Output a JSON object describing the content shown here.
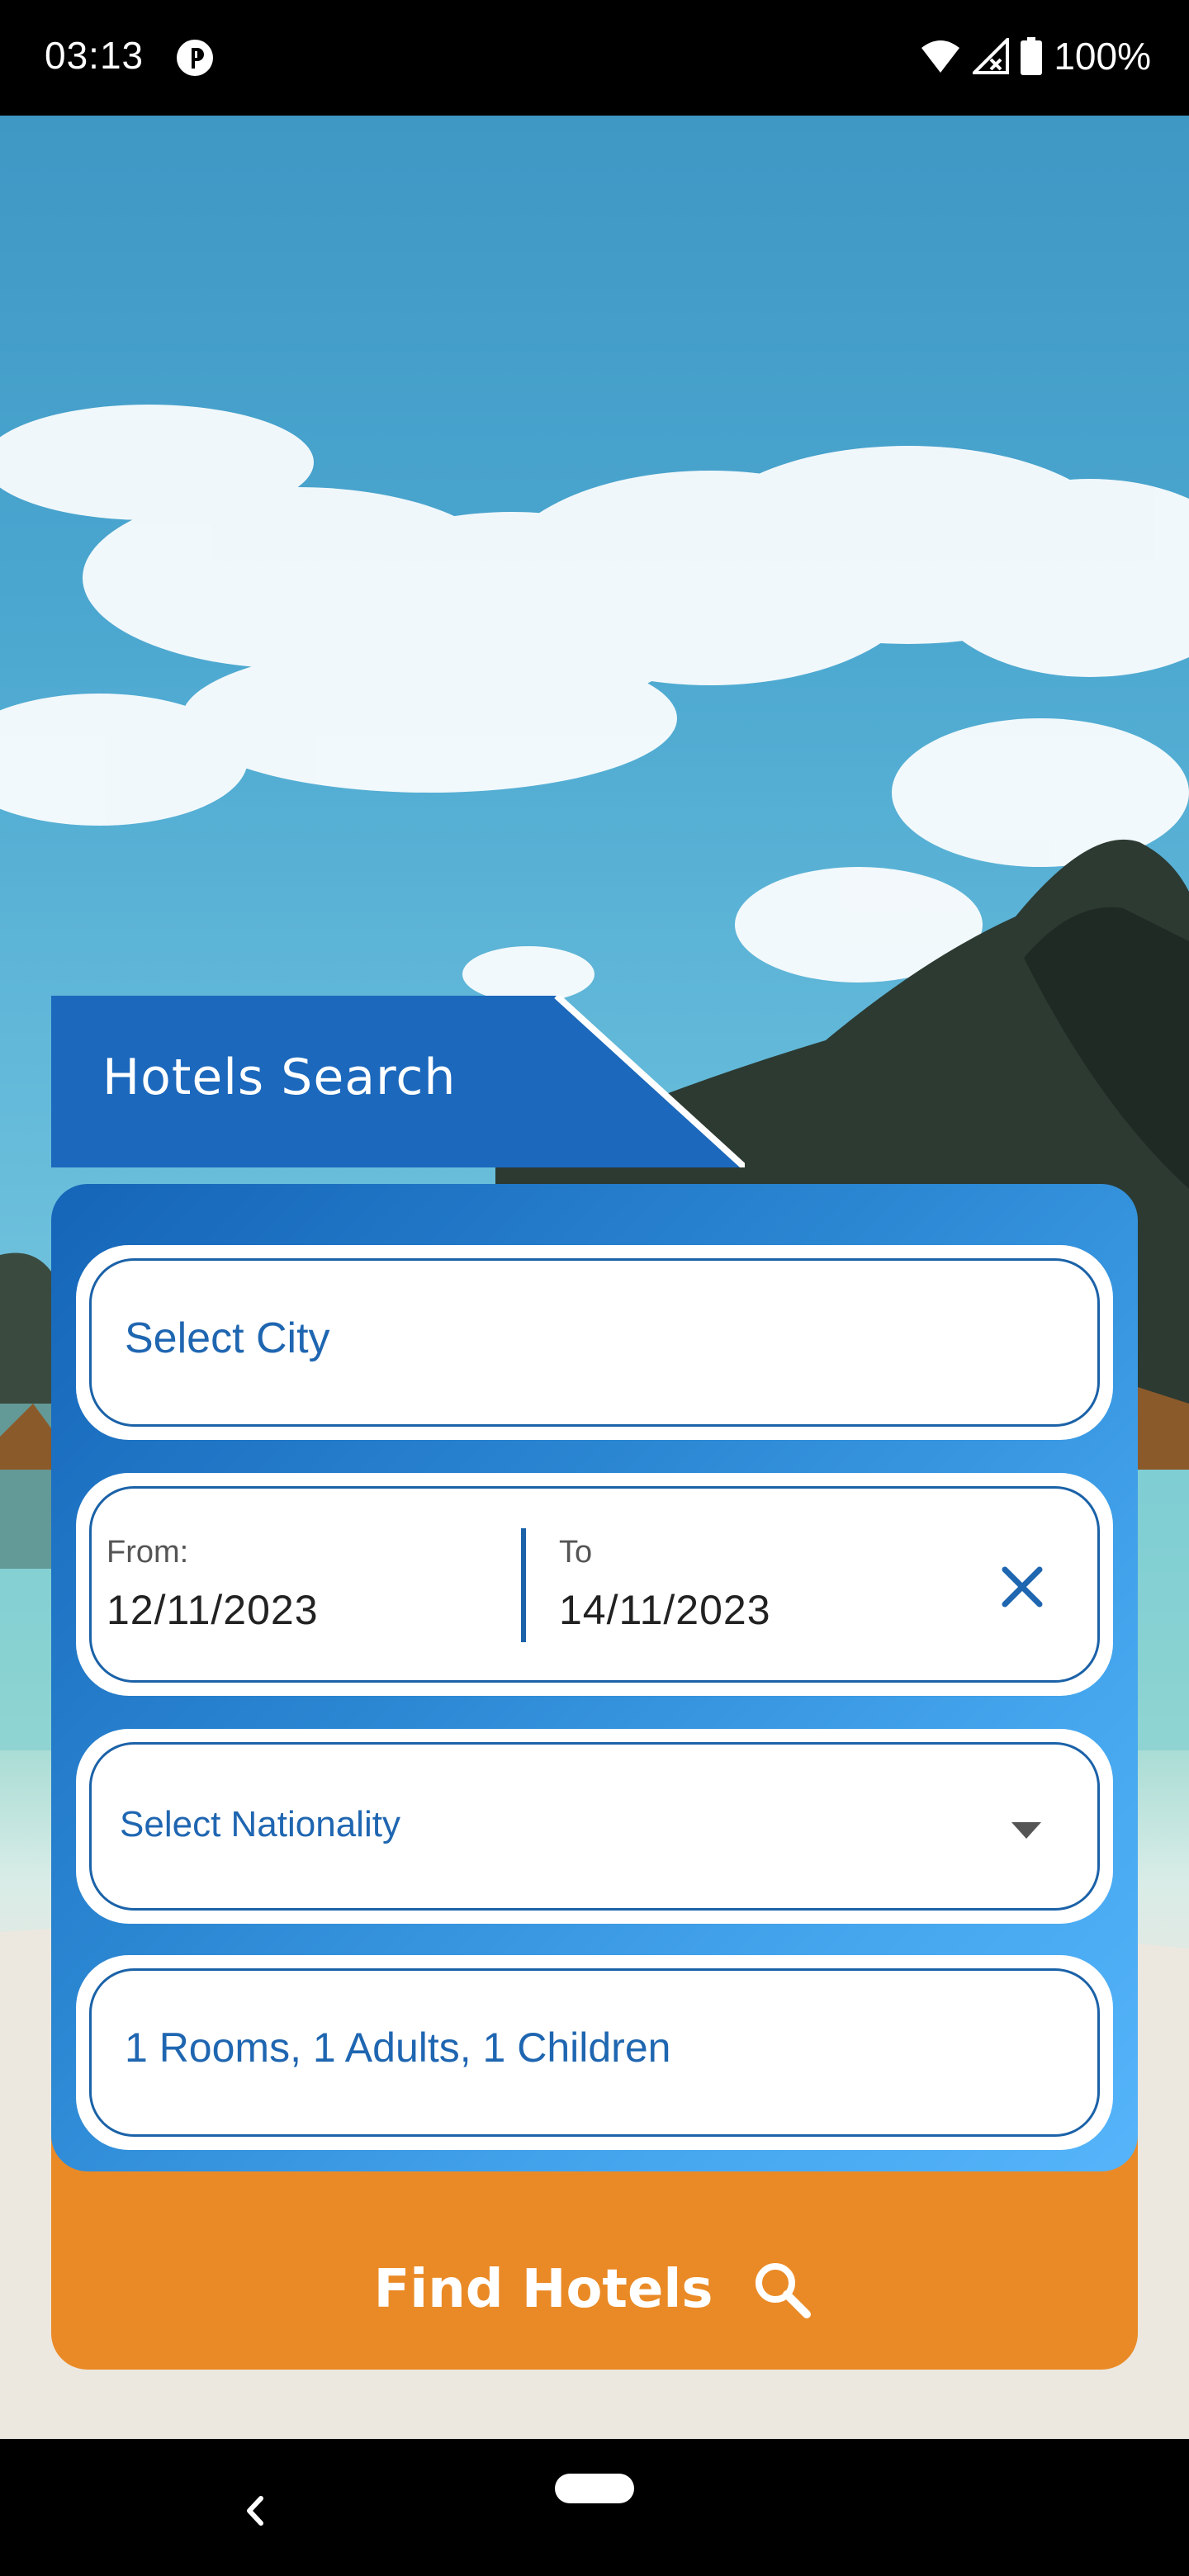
{
  "status_bar": {
    "time": "03:13",
    "battery": "100%",
    "icons": [
      "app-notification-icon",
      "wifi-icon",
      "signal-icon",
      "battery-icon"
    ]
  },
  "header": {
    "title": "Hotels Search"
  },
  "form": {
    "city_placeholder": "Select City",
    "dates": {
      "from_label": "From:",
      "from_value": "12/11/2023",
      "to_label": "To",
      "to_value": "14/11/2023"
    },
    "nationality_placeholder": "Select Nationality",
    "occupancy": "1 Rooms, 1 Adults, 1 Children"
  },
  "actions": {
    "find_label": "Find Hotels"
  },
  "colors": {
    "brand_blue": "#1b62a8",
    "accent_orange": "#ea8a26"
  }
}
